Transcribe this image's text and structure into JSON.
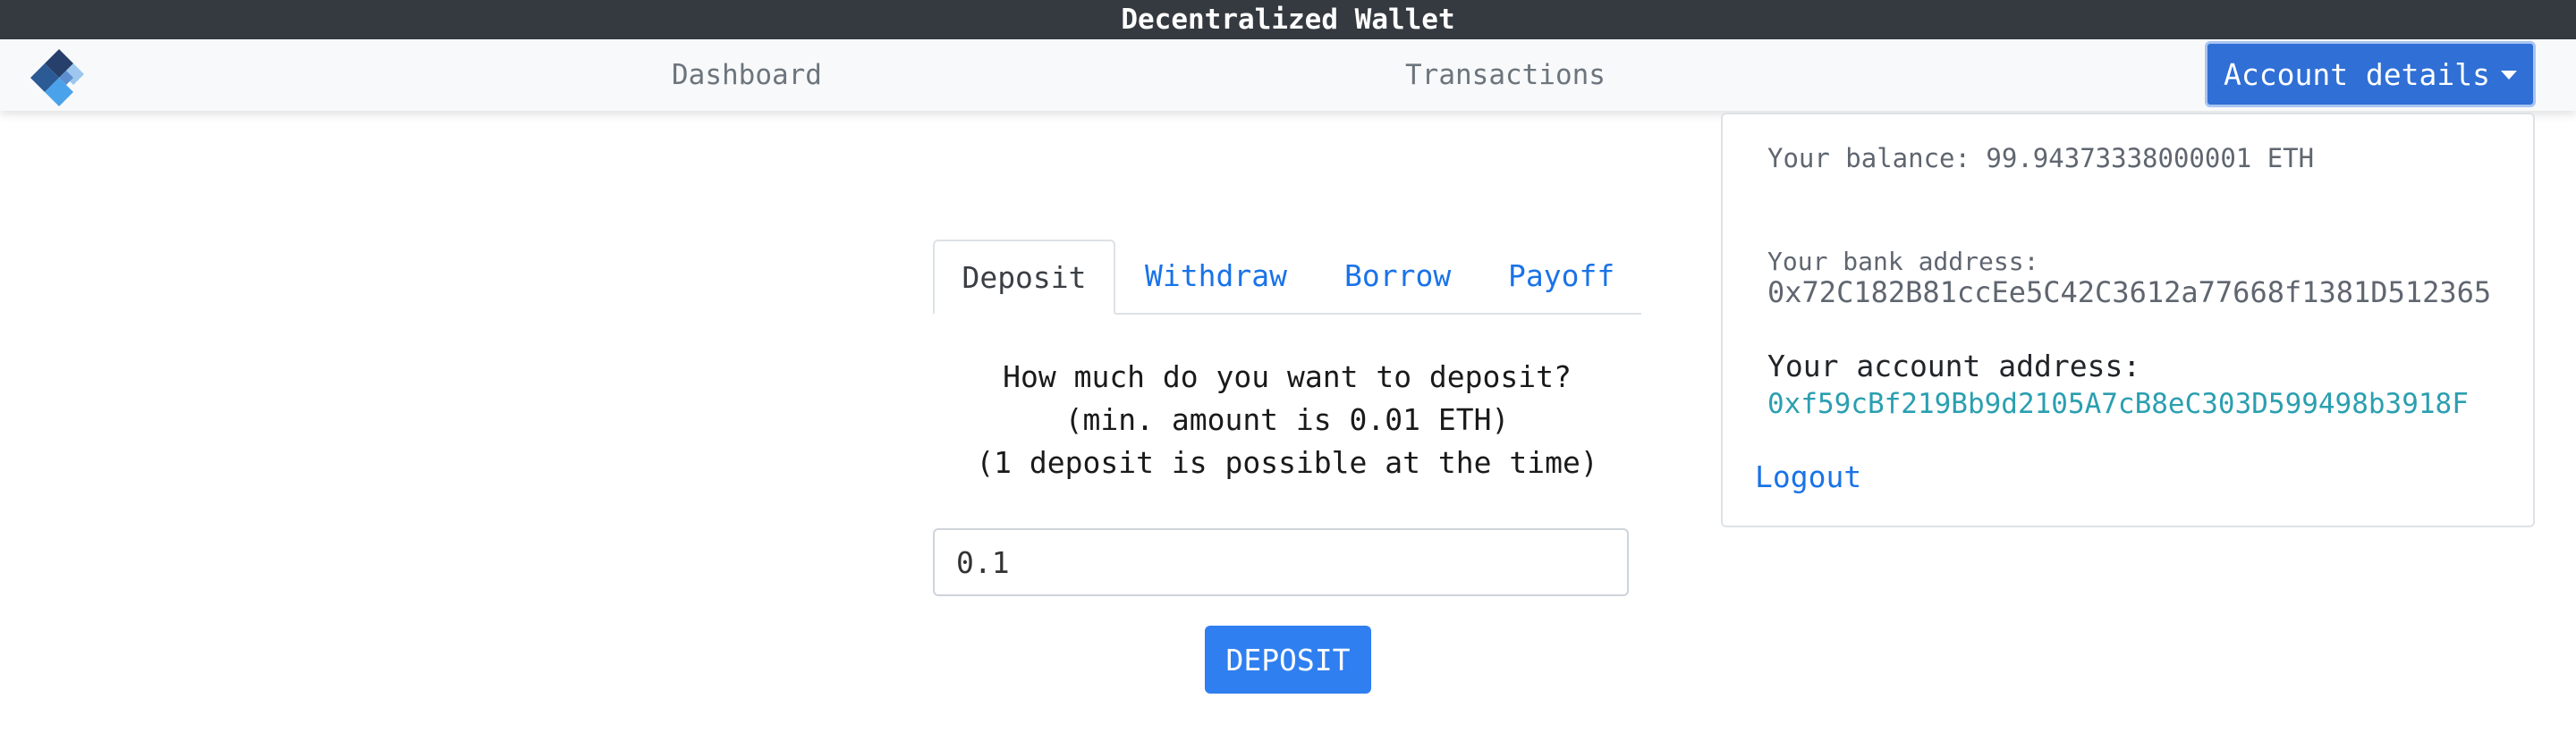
{
  "window": {
    "title": "Decentralized Wallet"
  },
  "nav": {
    "logo_icon": "diamond-logo-icon",
    "links": [
      "Dashboard",
      "Transactions"
    ],
    "account_button": "Account details",
    "account_button_color": "#2f6fd6"
  },
  "dropdown": {
    "balance": "Your balance: 99.94373338000001 ETH",
    "bank_label": "Your bank address:",
    "bank_address": "0x72C182B81ccEe5C42C3612a77668f1381D512365",
    "account_label": "Your account address:",
    "account_address": "0xf59cBf219Bb9d2105A7cB8eC303D599498b3918F",
    "logout": "Logout"
  },
  "tabs": [
    {
      "label": "Deposit",
      "active": true
    },
    {
      "label": "Withdraw",
      "active": false
    },
    {
      "label": "Borrow",
      "active": false
    },
    {
      "label": "Payoff",
      "active": false
    }
  ],
  "deposit_form": {
    "prompt_lines": [
      "How much do you want to deposit?",
      "(min. amount is 0.01 ETH)",
      "(1 deposit is possible at the time)"
    ],
    "amount_value": "0.1",
    "submit_label": "DEPOSIT",
    "submit_color": "#2f7ff0"
  }
}
